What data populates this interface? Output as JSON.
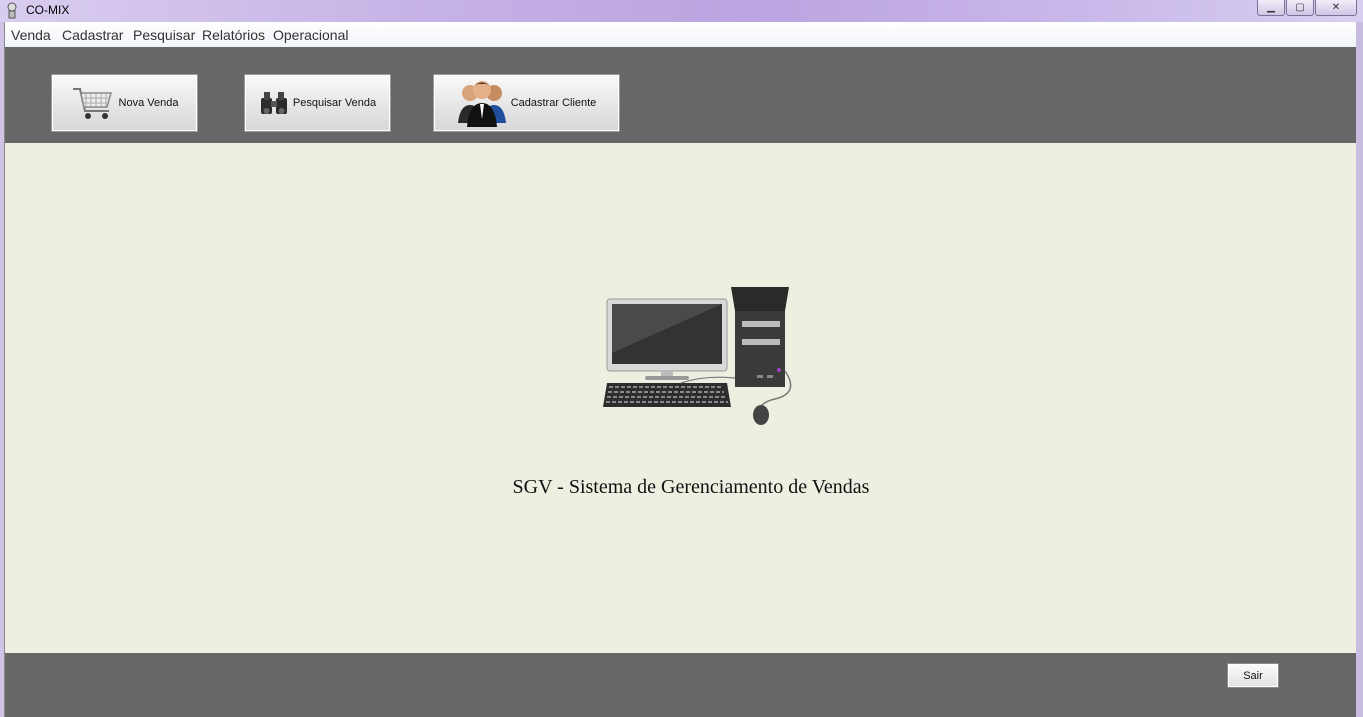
{
  "window": {
    "title": "CO-MIX"
  },
  "menu": [
    "Venda",
    "Cadastrar",
    "Pesquisar",
    "Relatórios",
    "Operacional"
  ],
  "toolbar": {
    "nova_venda": "Nova Venda",
    "pesquisar_venda": "Pesquisar Venda",
    "cadastrar_cliente": "Cadastrar Cliente"
  },
  "main": {
    "title": "SGV - Sistema de Gerenciamento de Vendas"
  },
  "footer": {
    "sair": "Sair"
  },
  "colors": {
    "toolbar_bg": "#676767",
    "main_bg": "#efefe1"
  }
}
